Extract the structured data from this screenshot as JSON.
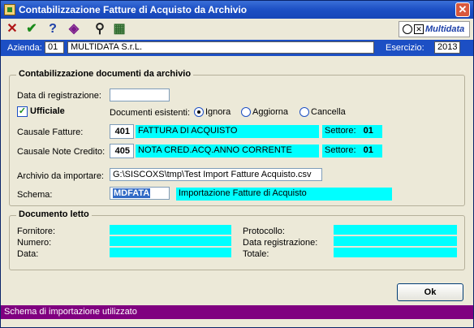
{
  "window": {
    "title": "Contabilizzazione Fatture di Acquisto da Archivio",
    "close_glyph": "✕"
  },
  "toolbar": {
    "buttons": [
      {
        "icon": "close-x-icon",
        "glyph": "✕",
        "color": "#b01515"
      },
      {
        "icon": "check-icon",
        "glyph": "✔",
        "color": "#1a8a1a"
      },
      {
        "icon": "help-icon",
        "glyph": "?",
        "color": "#1c3fa8"
      },
      {
        "icon": "diamond-tool-icon",
        "glyph": "◈",
        "color": "#7a1a8a"
      },
      {
        "icon": "binoculars-icon",
        "glyph": "⚲",
        "color": "#202020"
      },
      {
        "icon": "spreadsheet-icon",
        "glyph": "▦",
        "color": "#2a6a2a"
      }
    ],
    "logo_text": "Multidata",
    "logo_x_glyph": "✕"
  },
  "company": {
    "azienda_label": "Azienda:",
    "azienda_code": "01",
    "azienda_name": "MULTIDATA S.r.L.",
    "esercizio_label": "Esercizio:",
    "esercizio_value": "2013"
  },
  "contabilizzazione": {
    "title": "Contabilizzazione documenti da archivio",
    "data_registrazione_label": "Data di registrazione:",
    "data_registrazione_value": "",
    "ufficiale_label": "Ufficiale",
    "ufficiale_checked_glyph": "✓",
    "documenti_esistenti_label": "Documenti esistenti:",
    "radio_options": [
      {
        "label": "Ignora",
        "selected": true
      },
      {
        "label": "Aggiorna",
        "selected": false
      },
      {
        "label": "Cancella",
        "selected": false
      }
    ],
    "causale_fatture_label": "Causale Fatture:",
    "causale_fatture_code": "401",
    "causale_fatture_desc": "FATTURA DI ACQUISTO",
    "causale_fatture_settore_label": "Settore:",
    "causale_fatture_settore_value": "01",
    "causale_nc_label": "Causale Note Credito:",
    "causale_nc_code": "405",
    "causale_nc_desc": "NOTA CRED.ACQ.ANNO CORRENTE",
    "causale_nc_settore_label": "Settore:",
    "causale_nc_settore_value": "01",
    "archivio_label": "Archivio da importare:",
    "archivio_value": "G:\\SISCOXS\\tmp\\Test Import Fatture Acquisto.csv",
    "schema_label": "Schema:",
    "schema_code": "MDFATA",
    "schema_desc": "Importazione Fatture di Acquisto"
  },
  "documento": {
    "title": "Documento letto",
    "fornitore_label": "Fornitore:",
    "numero_label": "Numero:",
    "data_label": "Data:",
    "protocollo_label": "Protocollo:",
    "data_registrazione_label": "Data registrazione:",
    "totale_label": "Totale:"
  },
  "buttons": {
    "ok": "Ok"
  },
  "status": {
    "text": "Schema di importazione utilizzato"
  },
  "colors": {
    "cyan": "#00ffff",
    "status_bar": "#800080",
    "title_blue": "#1c4fc4"
  }
}
